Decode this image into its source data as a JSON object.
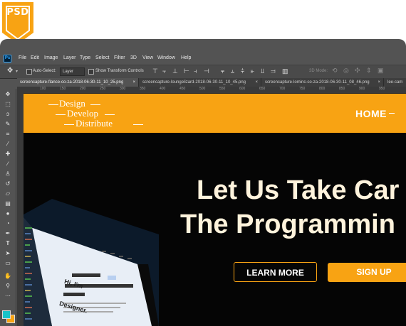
{
  "badge": {
    "label": "PSD"
  },
  "menu": [
    "File",
    "Edit",
    "Image",
    "Layer",
    "Type",
    "Select",
    "Filter",
    "3D",
    "View",
    "Window",
    "Help"
  ],
  "options": {
    "auto_select_label": "Auto-Select:",
    "auto_select_value": "Layer",
    "transform_controls_label": "Show Transform Controls",
    "mode_3d_label": "3D Mode:"
  },
  "tabs": [
    {
      "label": "screencapture-flance-co-za-2018-06-30-11_10_25.png"
    },
    {
      "label": "screencapture-loungelizard-2018-06-30-11_10_45.png"
    },
    {
      "label": "screencapture-lominc-co-za-2018-06-30-11_08_46.png"
    },
    {
      "label": "lee-cam"
    }
  ],
  "ruler_ticks": [
    "100",
    "150",
    "200",
    "250",
    "300",
    "350",
    "400",
    "450",
    "500",
    "550",
    "600",
    "650",
    "700",
    "750",
    "800",
    "850",
    "900",
    "950"
  ],
  "site": {
    "logo": [
      "Design",
      "Develop",
      "Distribute"
    ],
    "nav_home": "HOME",
    "hero_line1": "Let Us Take Car",
    "hero_line2": "The Programmin",
    "learn_more": "LEARN MORE",
    "sign_up": "SIGN UP",
    "laptop_screen_text": [
      "Hi, I'm",
      "Designer."
    ]
  },
  "colors": {
    "accent": "#f8a313",
    "app_bg": "#535353",
    "canvas_bg": "#050505",
    "hero_text": "#fff3dc",
    "ps_logo": "#31a8ff",
    "fg_swatch": "#19c3c9",
    "bg_swatch": "#f8a313"
  }
}
